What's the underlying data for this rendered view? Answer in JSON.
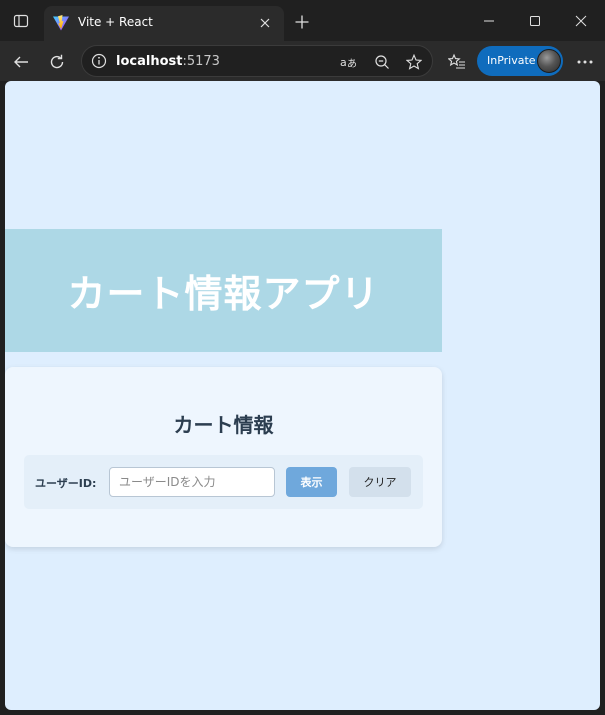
{
  "browser": {
    "tab": {
      "title": "Vite + React",
      "favicon": "vite-logo-icon"
    },
    "address": {
      "host": "localhost",
      "port": ":5173"
    },
    "profile": {
      "label": "InPrivate"
    },
    "colors": {
      "accent": "#0f6cbd",
      "chrome_dark": "#202020",
      "toolbar": "#2b2b2b"
    }
  },
  "app": {
    "title": "カート情報アプリ",
    "card": {
      "title": "カート情報",
      "user_id_label": "ユーザーID:",
      "user_id_placeholder": "ユーザーIDを入力",
      "user_id_value": "",
      "show_button": "表示",
      "clear_button": "クリア"
    },
    "colors": {
      "page_bg": "#deeefe",
      "header_bg": "#add8e6",
      "show_button_bg": "#6fa8dc",
      "clear_button_bg": "#d3e0ec"
    }
  }
}
